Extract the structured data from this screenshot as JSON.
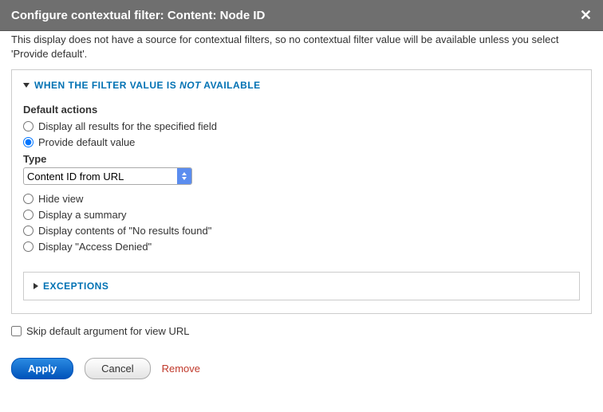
{
  "titlebar": {
    "title": "Configure contextual filter: Content: Node ID"
  },
  "helptext": "This display does not have a source for contextual filters, so no contextual filter value will be available unless you select 'Provide default'.",
  "fieldset": {
    "title_pre": "WHEN THE FILTER VALUE IS ",
    "title_not": "NOT",
    "title_post": " AVAILABLE",
    "default_actions_label": "Default actions",
    "options": {
      "display_all": "Display all results for the specified field",
      "provide_default": "Provide default value",
      "hide_view": "Hide view",
      "display_summary": "Display a summary",
      "no_results": "Display contents of \"No results found\"",
      "access_denied": "Display \"Access Denied\""
    },
    "type_label": "Type",
    "type_value": "Content ID from URL",
    "exceptions_label": "EXCEPTIONS"
  },
  "skip_label": "Skip default argument for view URL",
  "actions": {
    "apply": "Apply",
    "cancel": "Cancel",
    "remove": "Remove"
  }
}
